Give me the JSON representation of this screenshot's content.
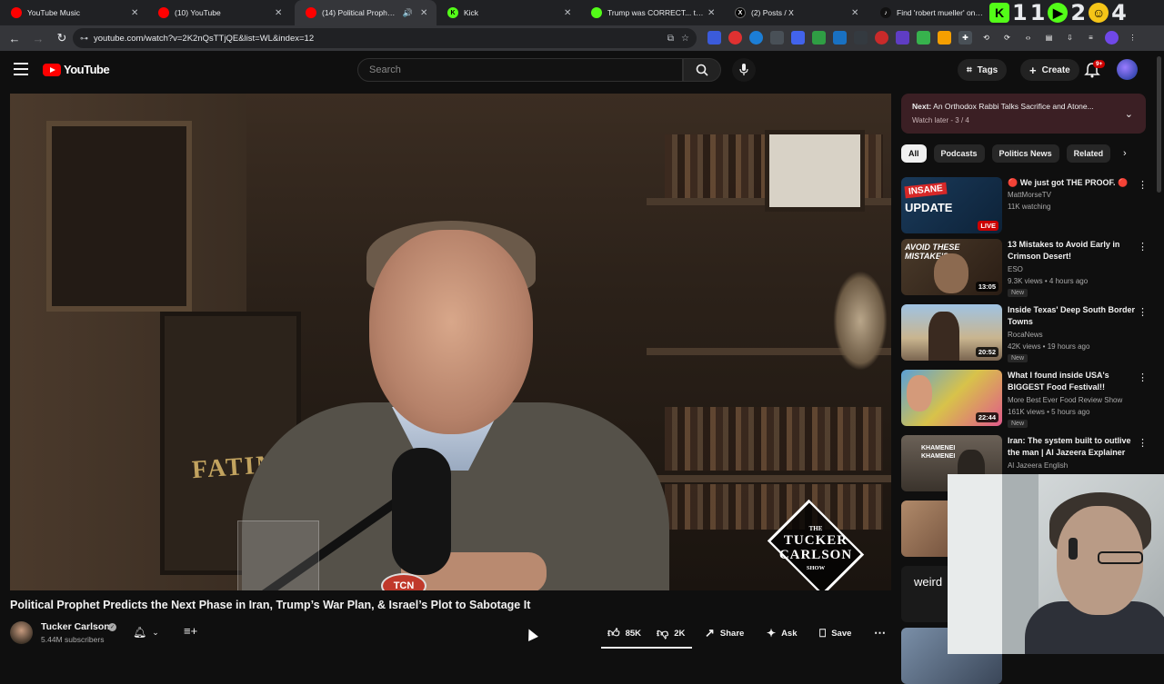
{
  "browser": {
    "tabs": [
      {
        "label": "YouTube Music",
        "fav_color": "#ff0000",
        "fav_glyph": "",
        "left": 0
      },
      {
        "label": "(10) YouTube",
        "fav_color": "#ff0000",
        "fav_glyph": ""
      },
      {
        "label": "(14) Political Prophet Predic",
        "fav_color": "#ff0000",
        "fav_glyph": ""
      },
      {
        "label": "Kick",
        "fav_color": "#53fc18",
        "fav_glyph": "K"
      },
      {
        "label": "Trump was CORRECT... the D",
        "fav_color": "#53fc18",
        "fav_glyph": ""
      },
      {
        "label": "(2) Posts / X",
        "fav_color": "#000000",
        "fav_glyph": "X"
      },
      {
        "label": "Find 'robert mueller' on TikTok",
        "fav_color": "#111111",
        "fav_glyph": "♪"
      }
    ],
    "url": "youtube.com/watch?v=2K2nQsTTjQE&list=WL&index=12",
    "overlay_numbers": [
      "1",
      "1",
      "2",
      "4"
    ]
  },
  "youtube": {
    "logo_text": "YouTube",
    "search_placeholder": "Search",
    "tags_label": "Tags",
    "create_label": "Create",
    "notif_badge": "9+"
  },
  "video": {
    "title": "Political Prophet Predicts the Next Phase in Iran, Trump’s War Plan, & Israel’s Plot to Sabotage It",
    "channel": "Tucker Carlson",
    "subscribers": "5.44M subscribers",
    "likes": "85K",
    "dislikes": "2K",
    "share_label": "Share",
    "ask_label": "Ask",
    "save_label": "Save",
    "overlay": {
      "fatima": "FATIMA",
      "mic_logo": "TCN",
      "show_the": "THE",
      "show_tucker": "TUCKER",
      "show_carlson": "CARLSON",
      "show_word": "SHOW"
    }
  },
  "sidebar": {
    "next_label": "Next:",
    "next_title": "An Orthodox Rabbi Talks Sacrifice and Atone...",
    "next_sub": "Watch later - 3 / 4",
    "chips": [
      "All",
      "Podcasts",
      "Politics News",
      "Related"
    ],
    "recs": [
      {
        "title": "🔴 We just got THE PROOF. 🔴",
        "channel": "MattMorseTV",
        "meta": "11K watching",
        "badge": "LIVE",
        "new": false,
        "thumb": "insane",
        "thumb_text": "INSANE UPDATE"
      },
      {
        "title": "13 Mistakes to Avoid Early in Crimson Desert!",
        "channel": "ESO",
        "meta": "9.3K views • 4 hours ago",
        "badge": "13:05",
        "new": true,
        "thumb": "crimson",
        "thumb_text": "AVOID THESE MISTAKE'S"
      },
      {
        "title": "Inside Texas' Deep South Border Towns",
        "channel": "RocaNews",
        "meta": "42K views • 19 hours ago",
        "badge": "20:52",
        "new": true,
        "thumb": "texas",
        "thumb_text": ""
      },
      {
        "title": "What I found inside USA's BIGGEST Food Festival!!",
        "channel": "More Best Ever Food Review Show",
        "meta": "161K views • 5 hours ago",
        "badge": "22:44",
        "new": true,
        "thumb": "food",
        "thumb_text": ""
      },
      {
        "title": "Iran: The system built to outlive the man | Al Jazeera Explainer",
        "channel": "Al Jazeera English",
        "meta": "",
        "badge": "",
        "new": false,
        "thumb": "iran",
        "thumb_text": "KHAMENEI KHAMENEI"
      },
      {
        "title": "",
        "channel": "",
        "meta": "",
        "badge": "",
        "new": false,
        "thumb": "people",
        "thumb_text": ""
      },
      {
        "title": "",
        "channel": "",
        "meta": "",
        "badge": "",
        "new": false,
        "thumb": "weird",
        "thumb_text": "weird"
      }
    ]
  },
  "colors": {
    "accent_red": "#ff0000",
    "next_panel_bg": "#3b1f24",
    "page_bg": "#0f0f0f"
  }
}
